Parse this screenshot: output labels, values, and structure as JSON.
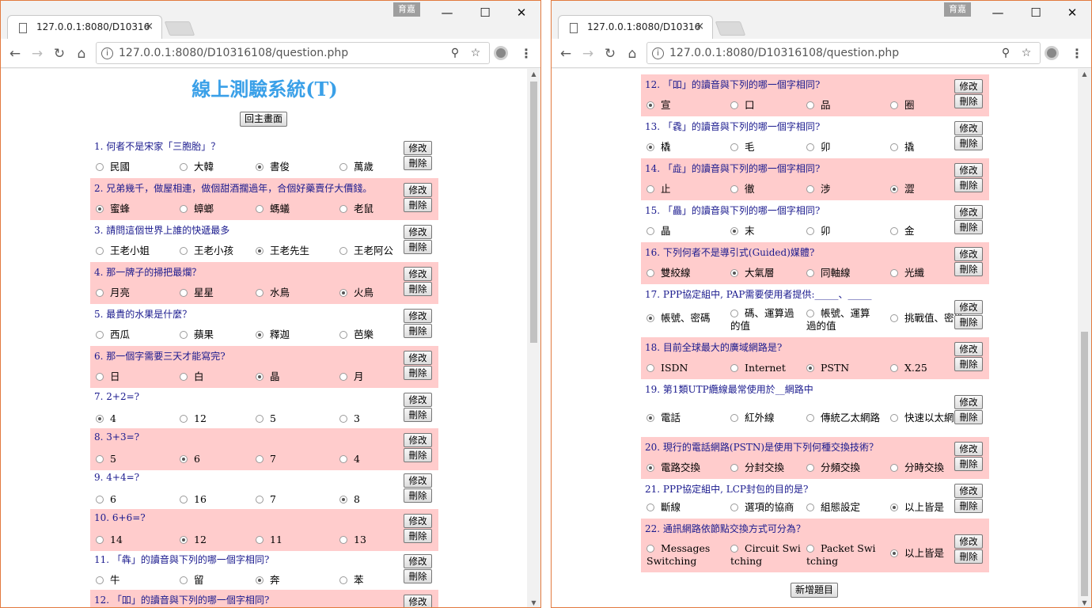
{
  "browser": {
    "ime_label": "育嘉",
    "tab_title": "127.0.0.1:8080/D10316",
    "tab_close": "×",
    "url": "127.0.0.1:8080/D10316108/question.php",
    "minimize": "—",
    "maximize": "☐",
    "close": "✕",
    "back": "←",
    "forward": "→",
    "reload": "↻",
    "home": "⌂",
    "info": "i",
    "zoom": "⚲",
    "star": "☆",
    "menu": "⋮"
  },
  "page": {
    "title": "線上測驗系統(T)",
    "home_button": "回主畫面",
    "add_button": "新增題目",
    "edit_label": "修改",
    "delete_label": "刪除"
  },
  "questions": [
    {
      "text": "1. 何者不是宋家「三胞胎」？",
      "options": [
        "民國",
        "大韓",
        "書俊",
        "萬歲"
      ],
      "selected": 2
    },
    {
      "text": "2. 兄弟幾千，做屋相連，做個甜酒擱過年，合個好藥賣仔大價錢。",
      "options": [
        "蜜蜂",
        "蟑螂",
        "螞蟻",
        "老鼠"
      ],
      "selected": 0
    },
    {
      "text": "3. 請問這個世界上誰的快遞最多",
      "options": [
        "王老小姐",
        "王老小孩",
        "王老先生",
        "王老阿公"
      ],
      "selected": 2
    },
    {
      "text": "4. 那一牌子的掃把最爛？",
      "options": [
        "月亮",
        "星星",
        "水鳥",
        "火鳥"
      ],
      "selected": 3
    },
    {
      "text": "5. 最貴的水果是什麼？",
      "options": [
        "西瓜",
        "蘋果",
        "釋迦",
        "芭樂"
      ],
      "selected": 2
    },
    {
      "text": "6. 那一個字需要三天才能寫完?",
      "options": [
        "日",
        "白",
        "晶",
        "月"
      ],
      "selected": 2
    },
    {
      "text": "7. 2+2=?",
      "options": [
        "4",
        "12",
        "5",
        "3"
      ],
      "selected": 0
    },
    {
      "text": "8. 3+3=?",
      "options": [
        "5",
        "6",
        "7",
        "4"
      ],
      "selected": 1
    },
    {
      "text": "9. 4+4=?",
      "options": [
        "6",
        "16",
        "7",
        "8"
      ],
      "selected": 3
    },
    {
      "text": "10. 6+6=?",
      "options": [
        "14",
        "12",
        "11",
        "13"
      ],
      "selected": 1
    },
    {
      "text": "11. 「犇」的讀音與下列的哪一個字相同?",
      "options": [
        "牛",
        "留",
        "奔",
        "苯"
      ],
      "selected": 2
    },
    {
      "text": "12. 「吅」的讀音與下列的哪一個字相同?",
      "options": [
        "宣",
        "口",
        "品",
        "圈"
      ],
      "selected": 0
    },
    {
      "text": "13. 「毳」的讀音與下列的哪一個字相同?",
      "options": [
        "橇",
        "毛",
        "卯",
        "撬"
      ],
      "selected": 0
    },
    {
      "text": "14. 「歮」的讀音與下列的哪一個字相同?",
      "options": [
        "止",
        "徹",
        "涉",
        "澀"
      ],
      "selected": 3
    },
    {
      "text": "15. 「畾」的讀音與下列的哪一個字相同?",
      "options": [
        "晶",
        "末",
        "卯",
        "金"
      ],
      "selected": 1
    },
    {
      "text": "16. 下列何者不是導引式(Guided)媒體?",
      "options": [
        "雙絞線",
        "大氣層",
        "同軸線",
        "光纖"
      ],
      "selected": 1
    },
    {
      "text": "17. PPP協定組中, PAP需要使用者提供:_____、_____",
      "options": [
        "帳號、密碼",
        "碼、運算過的值",
        "帳號、運算過的值",
        "挑戰值、密碼"
      ],
      "selected": 0
    },
    {
      "text": "18. 目前全球最大的廣域網路是?",
      "options": [
        "ISDN",
        "Internet",
        "PSTN",
        "X.25"
      ],
      "selected": 2
    },
    {
      "text": "19. 第1類UTP纜線最常使用於__網路中",
      "options": [
        "電話",
        "紅外線",
        "傳統乙太網路",
        "快速以太網路"
      ],
      "selected": 0
    },
    {
      "text": "20. 現行的電話網路(PSTN)是使用下列何種交換技術？",
      "options": [
        "電路交換",
        "分封交換",
        "分頻交換",
        "分時交換"
      ],
      "selected": 0
    },
    {
      "text": "21. PPP協定組中, LCP封包的目的是?",
      "options": [
        "斷線",
        "選項的協商",
        "組態設定",
        "以上皆是"
      ],
      "selected": 3
    },
    {
      "text": "22. 通訊網路依節點交換方式可分為？",
      "options": [
        "Messages Switching",
        "Circuit Switching",
        "Packet Switching",
        "以上皆是"
      ],
      "selected": 3
    }
  ]
}
